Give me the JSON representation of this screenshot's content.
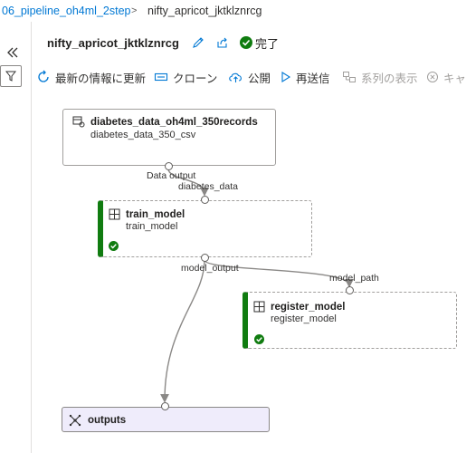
{
  "breadcrumb": {
    "parent": "06_pipeline_oh4ml_2step",
    "separator": ">",
    "current": "nifty_apricot_jktklznrcg"
  },
  "header": {
    "title": "nifty_apricot_jktklznrcg",
    "status": "完了",
    "status_color": "#107c10"
  },
  "toolbar": {
    "refresh": "最新の情報に更新",
    "clone": "クローン",
    "publish": "公開",
    "resubmit": "再送信",
    "lineage": "系列の表示",
    "cancel": "キャ"
  },
  "nodes": {
    "dataset": {
      "title": "diabetes_data_oh4ml_350records",
      "subtitle": "diabetes_data_350_csv",
      "output_label": "Data output"
    },
    "train": {
      "title": "train_model",
      "subtitle": "train_model",
      "input_label": "diabetes_data",
      "output_label": "model_output"
    },
    "register": {
      "title": "register_model",
      "subtitle": "register_model",
      "input_label": "model_path"
    },
    "outputs": {
      "title": "outputs"
    }
  },
  "colors": {
    "accent": "#0078d4",
    "success": "#107c10",
    "outputs_bg": "#efecfb"
  }
}
